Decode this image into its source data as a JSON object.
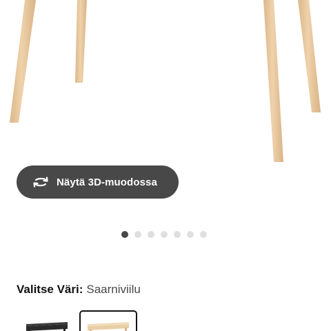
{
  "view_3d": {
    "label": "Näytä 3D-muodossa",
    "icon": "rotate-3d-icon"
  },
  "carousel": {
    "total": 7,
    "active_index": 0
  },
  "color_selector": {
    "prefix": "Valitse Väri:",
    "selected_value": "Saarniviilu",
    "options": [
      {
        "name": "black",
        "selected": false
      },
      {
        "name": "ash-veneer",
        "selected": true
      }
    ]
  },
  "colors": {
    "button_bg": "#484848",
    "dot_active": "#484848",
    "dot_inactive": "#dfdfdf",
    "wood": "#e8c9a0"
  }
}
